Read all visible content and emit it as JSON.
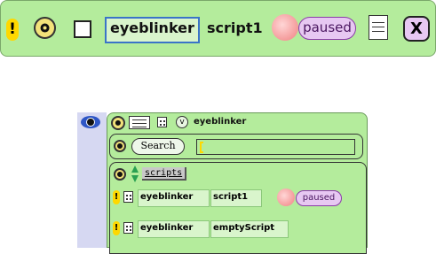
{
  "top_tile": {
    "exclaim": "!",
    "player_name": "eyeblinker",
    "script_name": "script1",
    "status": "paused",
    "close": "X"
  },
  "viewer": {
    "header_name": "eyeblinker",
    "header_chevron": "v",
    "search_label": "Search",
    "search_value": "",
    "category": "scripts",
    "rows": [
      {
        "exclaim": "!",
        "player": "eyeblinker",
        "script": "script1",
        "status": "paused"
      },
      {
        "exclaim": "!",
        "player": "eyeblinker",
        "script": "emptyScript",
        "status": ""
      }
    ]
  },
  "colors": {
    "tile_green": "#b4ec9c",
    "pill_purple": "#e7c8f2",
    "exclaim_yellow": "#ffd800",
    "highlight_blue": "#3a74c8"
  }
}
